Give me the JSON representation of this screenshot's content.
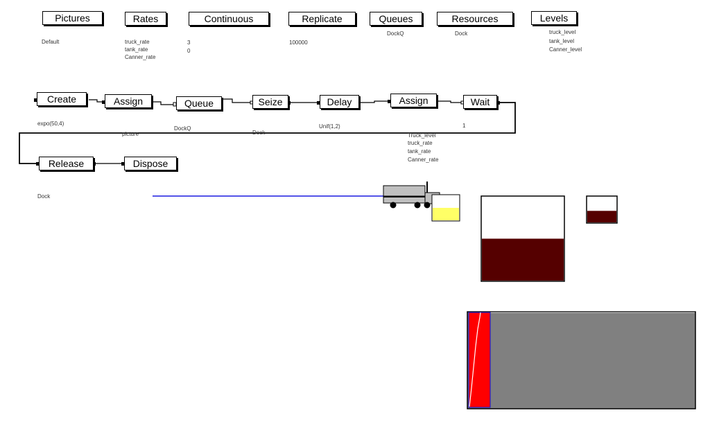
{
  "data_modules": [
    {
      "id": "pictures",
      "label": "Pictures",
      "values": [
        "Default"
      ]
    },
    {
      "id": "rates",
      "label": "Rates",
      "values": [
        "truck_rate",
        "tank_rate",
        "Canner_rate"
      ]
    },
    {
      "id": "continuous",
      "label": "Continuous",
      "values": [
        "3",
        "0"
      ]
    },
    {
      "id": "replicate",
      "label": "Replicate",
      "values": [
        "100000"
      ]
    },
    {
      "id": "queues",
      "label": "Queues",
      "values": [
        "DockQ"
      ]
    },
    {
      "id": "resources",
      "label": "Resources",
      "values": [
        "Dock"
      ]
    },
    {
      "id": "levels",
      "label": "Levels",
      "values": [
        "truck_level",
        "tank_level",
        "Canner_level"
      ]
    }
  ],
  "flow_modules": [
    {
      "id": "create",
      "label": "Create",
      "detail": [
        "expo(50,4)"
      ]
    },
    {
      "id": "assign1",
      "label": "Assign",
      "detail": [
        "picture"
      ]
    },
    {
      "id": "queue",
      "label": "Queue",
      "detail": [
        "DockQ"
      ]
    },
    {
      "id": "seize",
      "label": "Seize",
      "detail": [
        "Dock"
      ]
    },
    {
      "id": "delay",
      "label": "Delay",
      "detail": [
        "Unif(1,2)"
      ]
    },
    {
      "id": "assign2",
      "label": "Assign",
      "detail": [
        "Truck_level",
        "truck_rate",
        "tank_rate",
        "Canner_rate"
      ]
    },
    {
      "id": "wait",
      "label": "Wait",
      "detail": [
        "1"
      ]
    },
    {
      "id": "release",
      "label": "Release",
      "detail": [
        "Dock"
      ]
    },
    {
      "id": "dispose",
      "label": "Dispose",
      "detail": []
    }
  ],
  "animation": {
    "truck_tank_fill": 0.5,
    "tank_level_fill": 0.5,
    "canner_level_fill": 0.45,
    "colors": {
      "route_line": "#1a1ae0",
      "truck_fill": "#c0c0c0",
      "yellow_fill": "#ffff66",
      "level_fill": "#550000",
      "plot_bg": "#808080",
      "plot_bar": "#ff0000",
      "plot_bar_border": "#2222cc"
    }
  }
}
